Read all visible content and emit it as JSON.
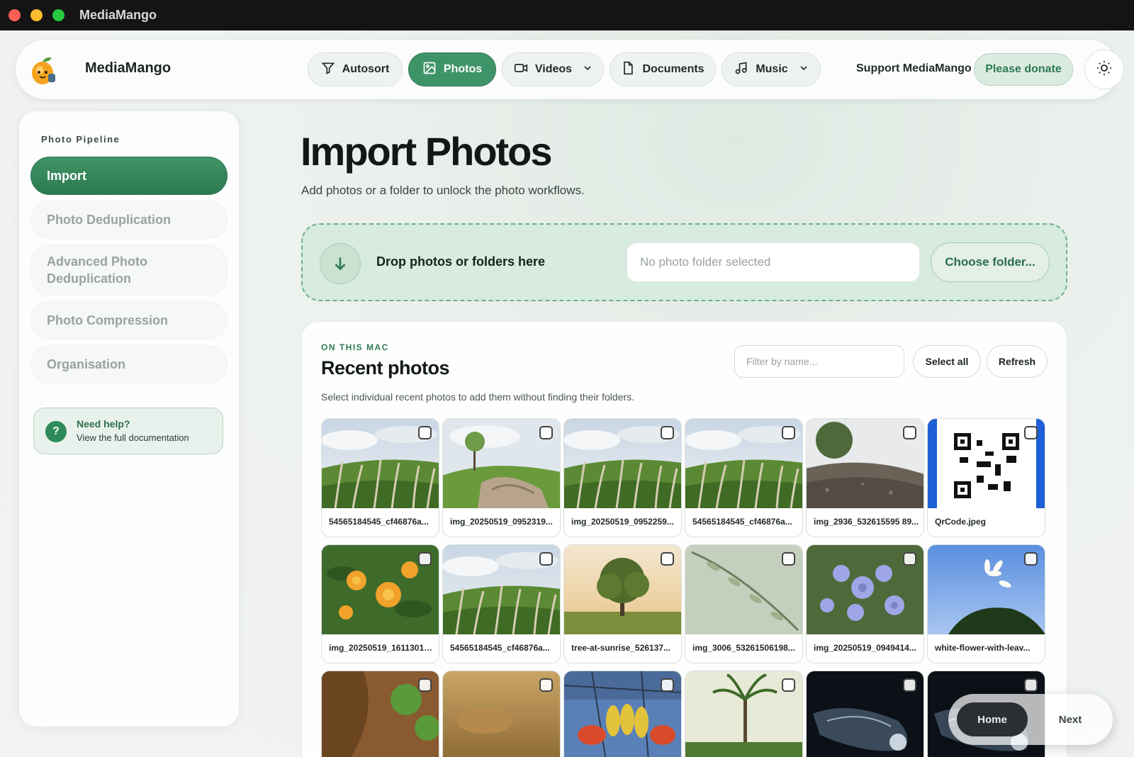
{
  "window": {
    "title": "MediaMango"
  },
  "nav": {
    "brand": "MediaMango",
    "tabs": [
      {
        "label": "Autosort",
        "icon": "funnel-icon"
      },
      {
        "label": "Photos",
        "icon": "image-icon"
      },
      {
        "label": "Videos",
        "icon": "video-camera-icon"
      },
      {
        "label": "Documents",
        "icon": "document-icon"
      },
      {
        "label": "Music",
        "icon": "music-note-icon"
      }
    ],
    "support": "Support MediaMango",
    "donate": "Please donate",
    "theme_icon": "sun-icon"
  },
  "sidebar": {
    "heading": "Photo Pipeline",
    "items": [
      {
        "label": "Import"
      },
      {
        "label": "Photo Deduplication"
      },
      {
        "label": "Advanced Photo Deduplication"
      },
      {
        "label": "Photo Compression"
      },
      {
        "label": "Organisation"
      }
    ],
    "help": {
      "title": "Need help?",
      "subtitle": "View the full documentation",
      "icon_glyph": "?"
    }
  },
  "main": {
    "title": "Import Photos",
    "subtitle": "Add photos or a folder to unlock the photo workflows.",
    "dropzone": {
      "text": "Drop photos or folders here",
      "input_placeholder": "No photo folder selected",
      "button": "Choose folder..."
    },
    "recent": {
      "eyebrow": "ON THIS MAC",
      "title": "Recent photos",
      "description": "Select individual recent photos to add them without finding their folders.",
      "filter_placeholder": "Filter by name...",
      "select_all": "Select all",
      "refresh": "Refresh",
      "photos": [
        {
          "name": "54565184545_cf46876a...",
          "scene": "grass"
        },
        {
          "name": "img_20250519_0952319...",
          "scene": "rock-tree"
        },
        {
          "name": "img_20250519_0952259...",
          "scene": "grass"
        },
        {
          "name": "54565184545_cf46876a...",
          "scene": "grass"
        },
        {
          "name": "img_2936_532615595 89...",
          "scene": "rock"
        },
        {
          "name": "QrCode.jpeg",
          "scene": "qr"
        },
        {
          "name": "img_20250519_16113013...",
          "scene": "orange-flowers"
        },
        {
          "name": "54565184545_cf46876a...",
          "scene": "grass"
        },
        {
          "name": "tree-at-sunrise_526137...",
          "scene": "tree-sunrise"
        },
        {
          "name": "img_3006_53261506198...",
          "scene": "leaves"
        },
        {
          "name": "img_20250519_0949414...",
          "scene": "blue-flowers"
        },
        {
          "name": "white-flower-with-leav...",
          "scene": "white-flower"
        },
        {
          "name": "",
          "scene": "bark"
        },
        {
          "name": "",
          "scene": "sand"
        },
        {
          "name": "",
          "scene": "bananas"
        },
        {
          "name": "",
          "scene": "palm"
        },
        {
          "name": "",
          "scene": "dark-glass"
        },
        {
          "name": "",
          "scene": "dark-glass"
        }
      ]
    }
  },
  "footer": {
    "home": "Home",
    "next": "Next"
  },
  "colors": {
    "accent": "#3f9368",
    "accent_dark": "#2d7a50",
    "dropzone_bg": "#d8ebdf"
  }
}
